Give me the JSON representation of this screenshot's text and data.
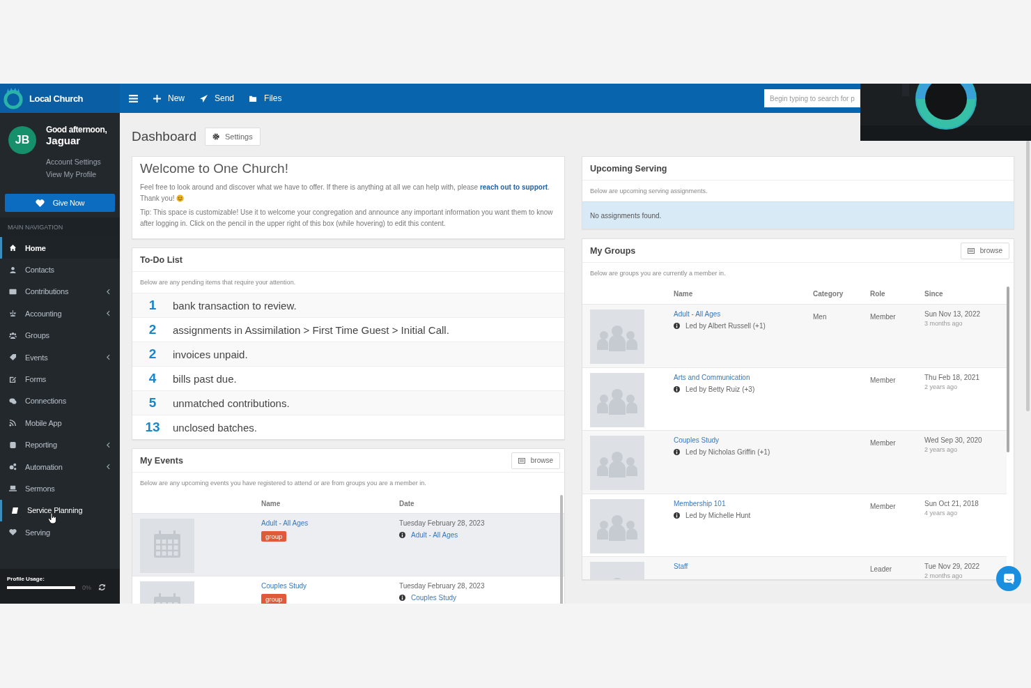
{
  "brand": {
    "name": "Local Church"
  },
  "topbar": {
    "actions": [
      {
        "label": "New"
      },
      {
        "label": "Send"
      },
      {
        "label": "Files"
      }
    ],
    "search": {
      "placeholder": "Begin typing to search for p"
    }
  },
  "user": {
    "initials": "JB",
    "greeting": "Good afternoon,",
    "name": "Jaguar",
    "links": [
      "Account Settings",
      "View My Profile"
    ]
  },
  "give_button": "Give Now",
  "nav_heading": "MAIN NAVIGATION",
  "nav": [
    {
      "label": "Home",
      "selected": true,
      "hovered": false,
      "expandable": false
    },
    {
      "label": "Contacts",
      "selected": false,
      "hovered": false,
      "expandable": false
    },
    {
      "label": "Contributions",
      "selected": false,
      "hovered": false,
      "expandable": true
    },
    {
      "label": "Accounting",
      "selected": false,
      "hovered": false,
      "expandable": true
    },
    {
      "label": "Groups",
      "selected": false,
      "hovered": false,
      "expandable": false
    },
    {
      "label": "Events",
      "selected": false,
      "hovered": false,
      "expandable": true
    },
    {
      "label": "Forms",
      "selected": false,
      "hovered": false,
      "expandable": false
    },
    {
      "label": "Connections",
      "selected": false,
      "hovered": false,
      "expandable": false
    },
    {
      "label": "Mobile App",
      "selected": false,
      "hovered": false,
      "expandable": false
    },
    {
      "label": "Reporting",
      "selected": false,
      "hovered": false,
      "expandable": true
    },
    {
      "label": "Automation",
      "selected": false,
      "hovered": false,
      "expandable": true
    },
    {
      "label": "Sermons",
      "selected": false,
      "hovered": false,
      "expandable": false
    },
    {
      "label": "Service Planning",
      "selected": false,
      "hovered": true,
      "expandable": false
    },
    {
      "label": "Serving",
      "selected": false,
      "hovered": false,
      "expandable": false
    }
  ],
  "profile_usage": {
    "label": "Profile Usage:",
    "level": 0,
    "reading": "0%"
  },
  "page": {
    "title": "Dashboard",
    "settings_button": "Settings"
  },
  "welcome": {
    "title": "Welcome to One Church!",
    "intro": {
      "before": "Feel free to look around and discover what we have to offer. If there is anything at all we can help with, please ",
      "link": "reach out to support",
      "after": ". Thank you!"
    },
    "tip": "Tip: This space is customizable! Use it to welcome your congregation and announce any important information you want them to know after logging in. Click on the pencil in the upper right of this box (while hovering) to edit this content."
  },
  "todo": {
    "title": "To-Do List",
    "description": "Below are any pending items that require your attention.",
    "items": [
      {
        "count": "1",
        "text": "bank transaction to review."
      },
      {
        "count": "2",
        "text": "assignments in Assimilation > First Time Guest > Initial Call."
      },
      {
        "count": "2",
        "text": "invoices unpaid."
      },
      {
        "count": "4",
        "text": "bills past due."
      },
      {
        "count": "5",
        "text": "unmatched contributions."
      },
      {
        "count": "13",
        "text": "unclosed batches."
      }
    ]
  },
  "events": {
    "title": "My Events",
    "browse_button": "browse",
    "description": "Below are any upcoming events you have registered to attend or are from groups you are a member in.",
    "columns": [
      "Name",
      "Date"
    ],
    "rows": [
      {
        "name": "Adult - All Ages",
        "tag": "group",
        "date": "Tuesday February 28, 2023",
        "group_link": "Adult - All Ages",
        "selected": true
      },
      {
        "name": "Couples Study",
        "tag": "group",
        "date": "Tuesday February 28, 2023",
        "group_link": "Couples Study",
        "selected": false
      }
    ]
  },
  "serving": {
    "title": "Upcoming Serving",
    "description": "Below are upcoming serving assignments.",
    "notice": "No assignments found."
  },
  "groups": {
    "title": "My Groups",
    "browse_button": "browse",
    "description": "Below are groups you are currently a member in.",
    "columns": [
      "Name",
      "Category",
      "Role",
      "Since"
    ],
    "rows": [
      {
        "name": "Adult - All Ages",
        "leader": "Led by Albert Russell (+1)",
        "category": "Men",
        "role": "Member",
        "since": "Sun Nov 13, 2022",
        "ago": "3 months ago"
      },
      {
        "name": "Arts and Communication",
        "leader": "Led by Betty Ruiz (+3)",
        "role": "Member",
        "since": "Thu Feb 18, 2021",
        "ago": "2 years ago"
      },
      {
        "name": "Couples Study",
        "leader": "Led by Nicholas Griffin (+1)",
        "role": "Member",
        "since": "Wed Sep 30, 2020",
        "ago": "2 years ago"
      },
      {
        "name": "Membership 101",
        "leader": "Led by Michelle Hunt",
        "role": "Member",
        "since": "Sun Oct 21, 2018",
        "ago": "4 years ago"
      },
      {
        "name": "Staff",
        "role": "Leader",
        "since": "Tue Nov 29, 2022",
        "ago": "2 months ago"
      }
    ]
  }
}
